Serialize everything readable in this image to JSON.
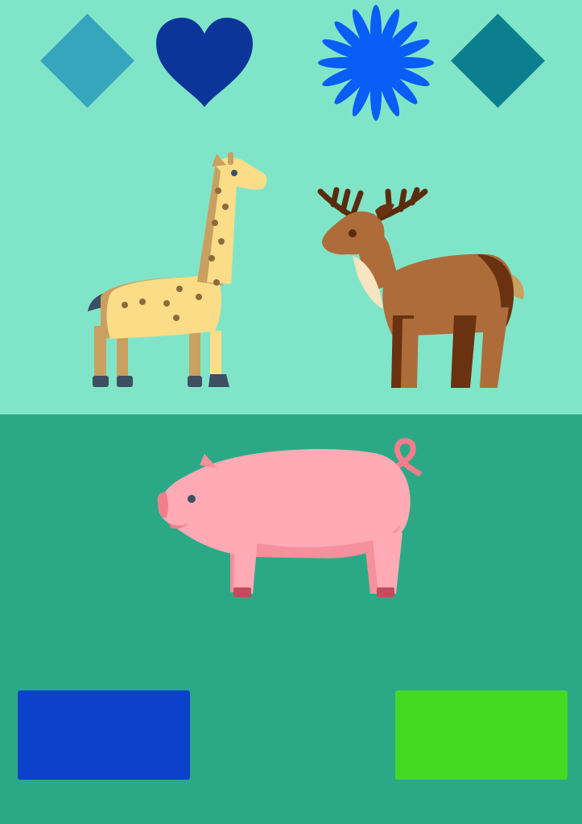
{
  "colors": {
    "background_top": "#80E5C8",
    "background_bottom": "#2BA986",
    "diamond_left": "#35A6BD",
    "heart": "#0C3599",
    "flower": "#0A5DF7",
    "diamond_right": "#0B7F8E",
    "rect_left": "#0C41CB",
    "rect_right": "#44DA24",
    "giraffe_body": "#FBDD88",
    "giraffe_shade": "#C9A060",
    "giraffe_spots": "#8A6B3B",
    "giraffe_hoof": "#3D4F61",
    "deer_body": "#AE6C3A",
    "deer_dark": "#6A3210",
    "deer_light": "#F7E4C0",
    "deer_antler": "#5A2C0D",
    "pig_body": "#FFAAB5",
    "pig_shade": "#F5909D",
    "pig_snout": "#F27E8C",
    "pig_hoof": "#C24D5C"
  },
  "icons": {
    "diamond_left": "diamond-icon",
    "heart": "heart-icon",
    "flower": "flower-icon",
    "diamond_right": "diamond-icon",
    "giraffe": "giraffe-icon",
    "deer": "deer-icon",
    "pig": "pig-icon"
  }
}
